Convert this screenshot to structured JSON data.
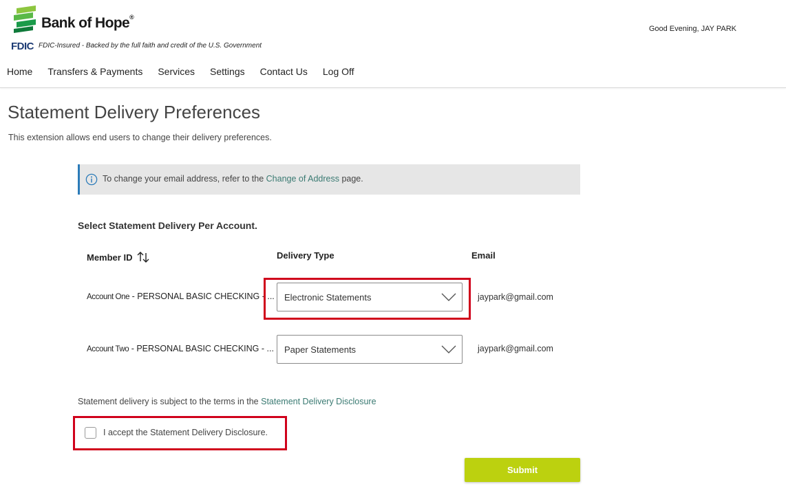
{
  "brand": {
    "name": "Bank of Hope",
    "reg_mark": "®",
    "fdic_label": "FDIC",
    "fdic_text": "FDIC-Insured - Backed by the full faith and credit of the U.S. Government",
    "logo_colors": [
      "#1a9b4a",
      "#8dc63f",
      "#5ab947"
    ]
  },
  "header": {
    "greeting": "Good Evening, JAY PARK"
  },
  "nav": {
    "items": [
      "Home",
      "Transfers & Payments",
      "Services",
      "Settings",
      "Contact Us",
      "Log Off"
    ]
  },
  "page": {
    "title": "Statement Delivery Preferences",
    "description": "This extension allows end users to change their delivery preferences."
  },
  "info": {
    "text_before": "To change your email address, refer to the ",
    "link": "Change of Address",
    "text_after": " page.",
    "icon": "info-circle-icon"
  },
  "table": {
    "section_title": "Select Statement Delivery Per Account.",
    "columns": [
      "Member ID",
      "Delivery Type",
      "Email"
    ],
    "sort_icon": "sort-arrows-icon",
    "rows": [
      {
        "nickname": "Account One",
        "account": "PERSONAL BASIC CHECKING - ...",
        "delivery": "Electronic Statements",
        "email": "jaypark@gmail.com"
      },
      {
        "nickname": "Account Two",
        "account": "PERSONAL BASIC CHECKING - ...",
        "delivery": "Paper Statements",
        "email": "jaypark@gmail.com"
      }
    ]
  },
  "disclosure": {
    "text": "Statement delivery is subject to the terms in the ",
    "link": "Statement Delivery Disclosure",
    "checkbox_label": "I accept the Statement Delivery Disclosure.",
    "checked": false
  },
  "submit": {
    "label": "Submit"
  },
  "colors": {
    "accent_green": "#bcd10f",
    "link": "#3a7a72",
    "highlight": "#d0021b",
    "info_border": "#2b7bb9"
  }
}
